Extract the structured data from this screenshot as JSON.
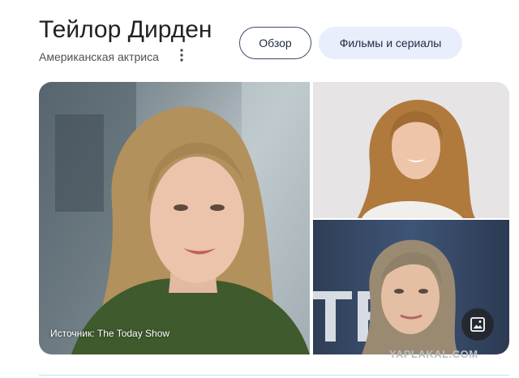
{
  "header": {
    "title": "Тейлор Дирден",
    "subtitle": "Американская актриса",
    "menu_icon": "more-vert-icon"
  },
  "chips": [
    {
      "label": "Обзор",
      "selected": true
    },
    {
      "label": "Фильмы и сериалы",
      "selected": false
    }
  ],
  "images": {
    "main": {
      "source_label": "Источник: The Today Show"
    },
    "lens_icon": "image-icon"
  },
  "watermark": "YAPLAKAL.COM",
  "colors": {
    "chip_selected_border": "#3c4a6b",
    "chip_bg": "#e8eefb",
    "text_primary": "#202124",
    "text_secondary": "#4d5156"
  }
}
